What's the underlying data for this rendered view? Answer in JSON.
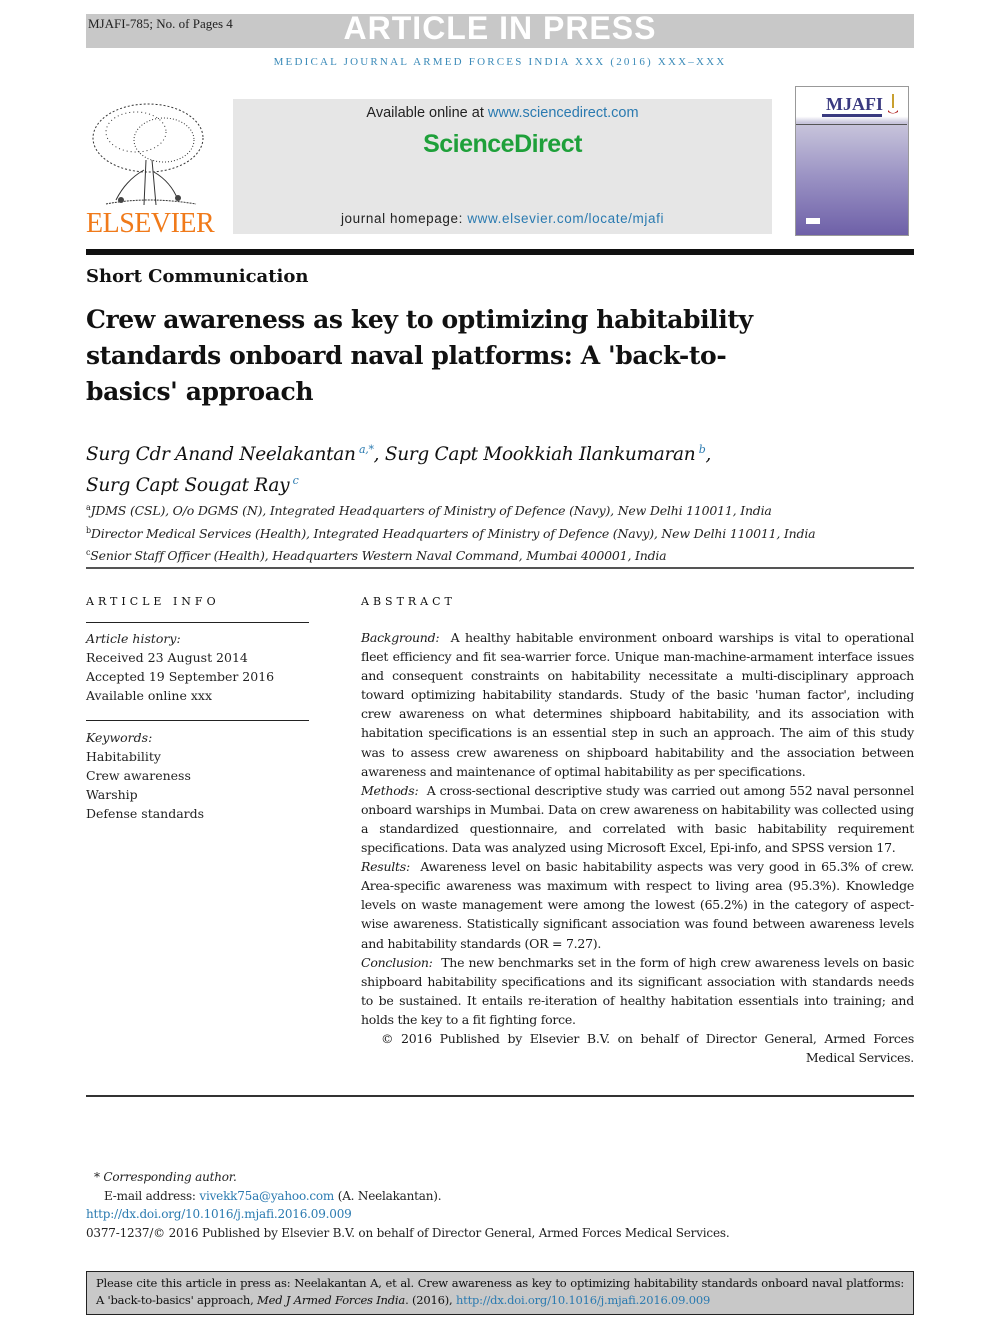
{
  "header": {
    "manuscript_id": "MJAFI-785; No. of Pages 4",
    "banner": "ARTICLE IN PRESS",
    "journal_line": "MEDICAL JOURNAL ARMED FORCES INDIA XXX (2016) XXX–XXX"
  },
  "masthead": {
    "publisher_logo": "ELSEVIER",
    "available_prefix": "Available online at ",
    "available_link": "www.sciencedirect.com",
    "platform": "ScienceDirect",
    "homepage_prefix": "journal homepage: ",
    "homepage_link": "www.elsevier.com/locate/mjafi",
    "cover_title": "MJAFI",
    "colors": {
      "elsevier_orange": "#f07a1a",
      "sciencedirect_green": "#1ea03a",
      "link_blue": "#2a7ab0"
    }
  },
  "article": {
    "section": "Short Communication",
    "title": "Crew awareness as key to optimizing habitability standards onboard naval platforms: A 'back-to-basics' approach",
    "authors": [
      {
        "name": "Surg Cdr Anand Neelakantan",
        "sup": "a,*",
        "sep": ", "
      },
      {
        "name": "Surg Capt Mookkiah Ilankumaran",
        "sup": "b",
        "sep": ","
      },
      {
        "name": "Surg Capt Sougat Ray",
        "sup": "c",
        "sep": ""
      }
    ],
    "affiliations": [
      {
        "key": "a",
        "text": "JDMS (CSL), O/o DGMS (N), Integrated Headquarters of Ministry of Defence (Navy), New Delhi 110011, India"
      },
      {
        "key": "b",
        "text": "Director Medical Services (Health), Integrated Headquarters of Ministry of Defence (Navy), New Delhi 110011, India"
      },
      {
        "key": "c",
        "text": "Senior Staff Officer (Health), Headquarters Western Naval Command, Mumbai 400001, India"
      }
    ]
  },
  "article_info": {
    "heading": "ARTICLE INFO",
    "history_label": "Article history:",
    "history": [
      "Received 23 August 2014",
      "Accepted 19 September 2016",
      "Available online xxx"
    ],
    "keywords_label": "Keywords:",
    "keywords": [
      "Habitability",
      "Crew awareness",
      "Warship",
      "Defense standards"
    ]
  },
  "abstract": {
    "heading": "ABSTRACT",
    "sections": [
      {
        "label": "Background:",
        "text": "A healthy habitable environment onboard warships is vital to operational fleet efficiency and fit sea-warrier force. Unique man-machine-armament interface issues and consequent constraints on habitability necessitate a multi-disciplinary approach toward optimizing habitability standards. Study of the basic 'human factor', including crew awareness on what determines shipboard habitability, and its association with habitation specifications is an essential step in such an approach. The aim of this study was to assess crew awareness on shipboard habitability and the association between awareness and maintenance of optimal habitability as per specifications."
      },
      {
        "label": "Methods:",
        "text": "A cross-sectional descriptive study was carried out among 552 naval personnel onboard warships in Mumbai. Data on crew awareness on habitability was collected using a standardized questionnaire, and correlated with basic habitability requirement specifications. Data was analyzed using Microsoft Excel, Epi-info, and SPSS version 17."
      },
      {
        "label": "Results:",
        "text": "Awareness level on basic habitability aspects was very good in 65.3% of crew. Area-specific awareness was maximum with respect to living area (95.3%). Knowledge levels on waste management were among the lowest (65.2%) in the category of aspect-wise awareness. Statistically significant association was found between awareness levels and habitability standards (OR = 7.27)."
      },
      {
        "label": "Conclusion:",
        "text": "The new benchmarks set in the form of high crew awareness levels on basic shipboard habitability specifications and its significant association with standards needs to be sustained. It entails re-iteration of healthy habitation essentials into training; and holds the key to a fit fighting force."
      }
    ],
    "copyright": "© 2016 Published by Elsevier B.V. on behalf of Director General, Armed Forces Medical Services."
  },
  "footnotes": {
    "corresponding_label": "* Corresponding author.",
    "email_prefix": "E-mail address: ",
    "email": "vivekk75a@yahoo.com",
    "email_suffix": " (A. Neelakantan).",
    "doi": "http://dx.doi.org/10.1016/j.mjafi.2016.09.009",
    "issn_line": "0377-1237/© 2016 Published by Elsevier B.V. on behalf of Director General, Armed Forces Medical Services."
  },
  "citation": {
    "prefix": "Please cite this article in press as: Neelakantan A, et al. Crew awareness as key to optimizing habitability standards onboard naval platforms: A 'back-to-basics' approach, ",
    "journal": "Med J Armed Forces India",
    "year": ". (2016), ",
    "doi": "http://dx.doi.org/10.1016/j.mjafi.2016.09.009"
  }
}
